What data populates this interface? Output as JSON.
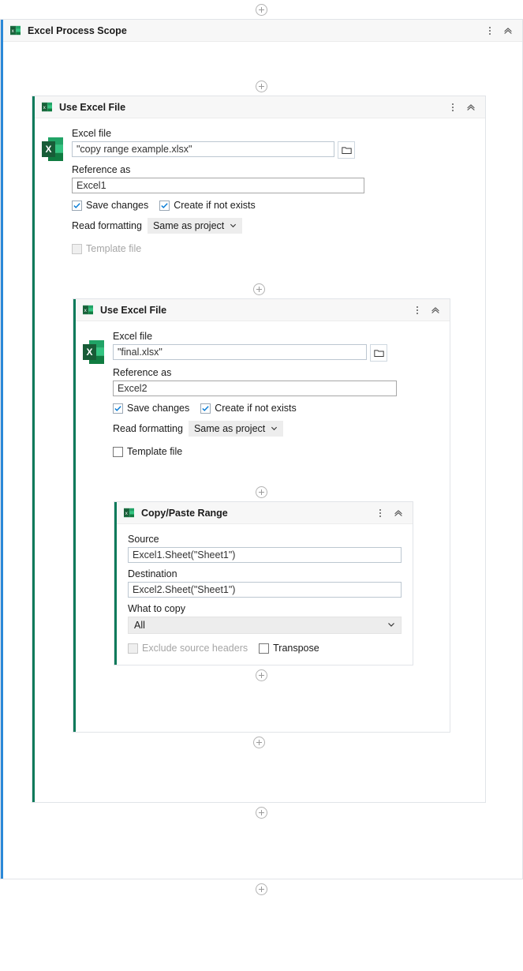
{
  "colors": {
    "scope_accent": "#2b88d8",
    "activity_accent": "#0b7a5a",
    "header_bg": "#f7f7f7",
    "card_border": "#e1e4e8",
    "excel_green": "#1d7044",
    "check_blue": "#0078d4"
  },
  "connectors": {
    "add_label": "+"
  },
  "scope": {
    "title": "Excel Process Scope",
    "icon": "excel-icon",
    "menu_icon": "kebab-menu-icon",
    "collapse_icon": "collapse-chevron-icon"
  },
  "use_excel_file_1": {
    "title": "Use Excel File",
    "icon": "excel-icon",
    "menu_icon": "kebab-menu-icon",
    "collapse_icon": "collapse-chevron-icon",
    "excel_file_label": "Excel file",
    "excel_file_value": "\"copy range example.xlsx\"",
    "browse_icon": "folder-icon",
    "reference_label": "Reference as",
    "reference_value": "Excel1",
    "save_changes_label": "Save changes",
    "save_changes_checked": true,
    "create_if_not_exists_label": "Create if not exists",
    "create_if_not_exists_checked": true,
    "read_formatting_label": "Read formatting",
    "read_formatting_value": "Same as project",
    "template_file_label": "Template file",
    "template_file_checked": false,
    "template_file_disabled": true
  },
  "use_excel_file_2": {
    "title": "Use Excel File",
    "icon": "excel-icon",
    "menu_icon": "kebab-menu-icon",
    "collapse_icon": "collapse-chevron-icon",
    "excel_file_label": "Excel file",
    "excel_file_value": "\"final.xlsx\"",
    "browse_icon": "folder-icon",
    "reference_label": "Reference as",
    "reference_value": "Excel2",
    "save_changes_label": "Save changes",
    "save_changes_checked": true,
    "create_if_not_exists_label": "Create if not exists",
    "create_if_not_exists_checked": true,
    "read_formatting_label": "Read formatting",
    "read_formatting_value": "Same as project",
    "template_file_label": "Template file",
    "template_file_checked": false,
    "template_file_disabled": false
  },
  "copy_paste_range": {
    "title": "Copy/Paste Range",
    "icon": "excel-icon",
    "menu_icon": "kebab-menu-icon",
    "collapse_icon": "collapse-chevron-icon",
    "source_label": "Source",
    "source_value": "Excel1.Sheet(\"Sheet1\")",
    "destination_label": "Destination",
    "destination_value": "Excel2.Sheet(\"Sheet1\")",
    "what_to_copy_label": "What to copy",
    "what_to_copy_value": "All",
    "exclude_headers_label": "Exclude source headers",
    "exclude_headers_checked": false,
    "exclude_headers_disabled": true,
    "transpose_label": "Transpose",
    "transpose_checked": false,
    "transpose_disabled": false
  }
}
